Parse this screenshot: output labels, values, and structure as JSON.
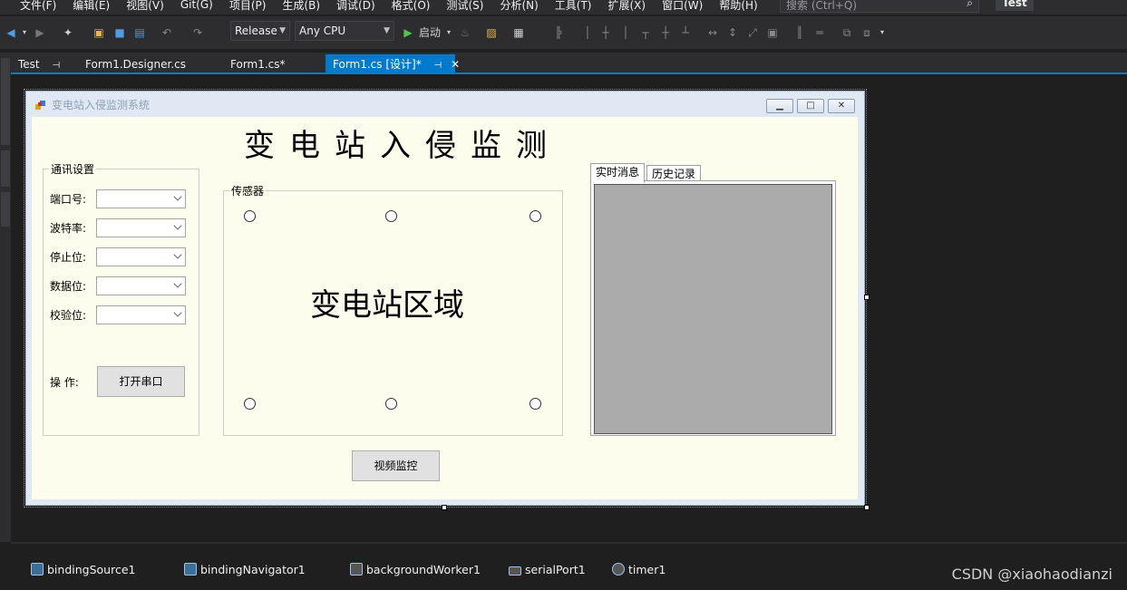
{
  "menu": {
    "items": [
      "文件(F)",
      "编辑(E)",
      "视图(V)",
      "Git(G)",
      "项目(P)",
      "生成(B)",
      "调试(D)",
      "格式(O)",
      "测试(S)",
      "分析(N)",
      "工具(T)",
      "扩展(X)",
      "窗口(W)",
      "帮助(H)"
    ],
    "search_placeholder": "搜索 (Ctrl+Q)",
    "solution_name": "Test"
  },
  "toolbar": {
    "configuration": "Release",
    "platform": "Any CPU",
    "start_label": "启动"
  },
  "tabs": [
    {
      "label": "Test",
      "pin": "⊣"
    },
    {
      "label": "Form1.Designer.cs"
    },
    {
      "label": "Form1.cs*"
    },
    {
      "label": "Form1.cs [设计]*",
      "active": true
    }
  ],
  "form": {
    "window_title": "变电站入侵监测系统",
    "heading": "变电站入侵监测",
    "comm_group": {
      "title": "通讯设置",
      "fields": [
        {
          "label": "端口号:",
          "value": ""
        },
        {
          "label": "波特率:",
          "value": ""
        },
        {
          "label": "停止位:",
          "value": ""
        },
        {
          "label": "数据位:",
          "value": ""
        },
        {
          "label": "校验位:",
          "value": ""
        }
      ],
      "op_label": "操 作:",
      "open_port_button": "打开串口"
    },
    "sensor_group": {
      "title": "传感器",
      "area_text": "变电站区域",
      "sensor_count": 6
    },
    "video_button": "视频监控",
    "message_tabs": [
      "实时消息",
      "历史记录"
    ]
  },
  "components": [
    "bindingSource1",
    "bindingNavigator1",
    "backgroundWorker1",
    "serialPort1",
    "timer1"
  ],
  "watermark": "CSDN @xiaohaodianzi",
  "colors": {
    "accent": "#007acc",
    "ide_bg": "#1f1f1f",
    "form_bg": "#fdfdee",
    "list_gray": "#ababab"
  }
}
